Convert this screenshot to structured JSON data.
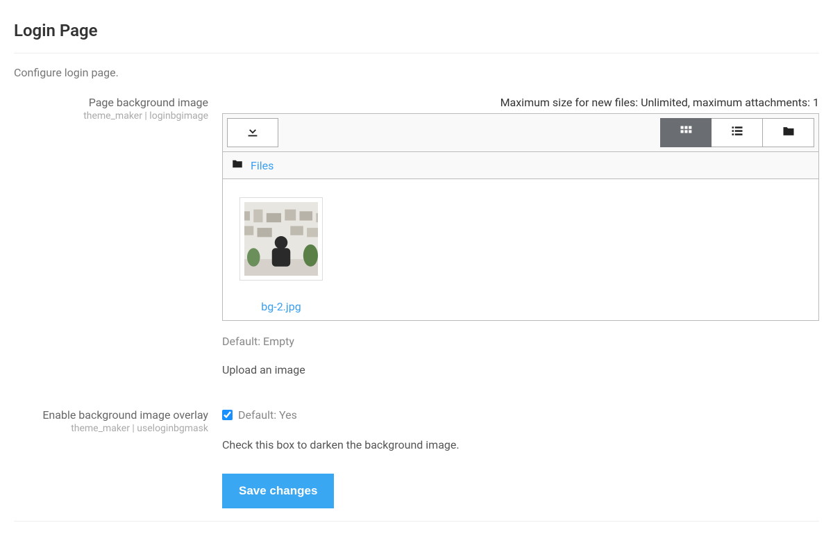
{
  "page": {
    "title": "Login Page",
    "description": "Configure login page."
  },
  "settings": {
    "bgimage": {
      "label": "Page background image",
      "key": "theme_maker | loginbgimage",
      "max_size_text": "Maximum size for new files: Unlimited, maximum attachments: 1",
      "breadcrumb": {
        "root_label": "Files"
      },
      "files": [
        {
          "name": "bg-2.jpg"
        }
      ],
      "default_text": "Default: Empty",
      "help": "Upload an image"
    },
    "overlay": {
      "label": "Enable background image overlay",
      "key": "theme_maker | useloginbgmask",
      "checked": true,
      "default_text": "Default: Yes",
      "help": "Check this box to darken the background image."
    }
  },
  "actions": {
    "save_label": "Save changes"
  }
}
